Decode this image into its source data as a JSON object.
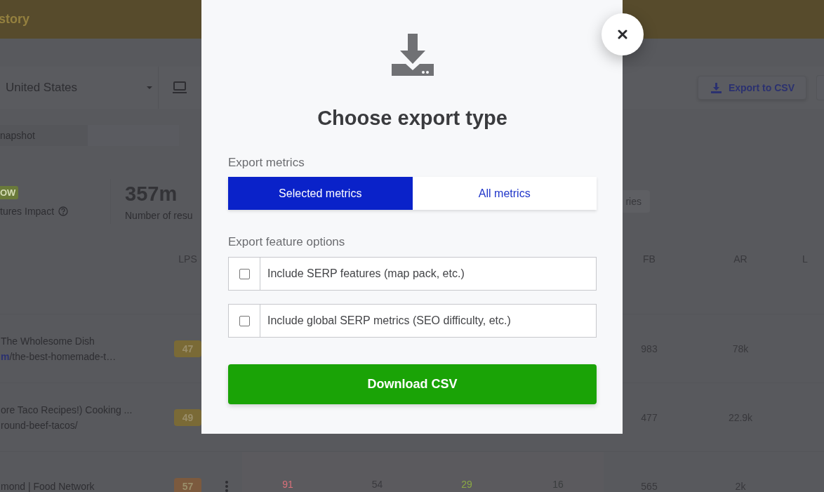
{
  "header": {
    "title": "story"
  },
  "toolbar": {
    "location": "United States",
    "export_button": "Export to CSV"
  },
  "view_tab": {
    "label": "napshot"
  },
  "stats": [
    {
      "badge": "OW",
      "label": "tures Impact"
    },
    {
      "value": "357m",
      "label": "Number of resu"
    }
  ],
  "chip": {
    "label": "ries"
  },
  "table": {
    "columns": [
      {
        "label": "LPS"
      },
      {
        "label": "FB"
      },
      {
        "label": "AR"
      },
      {
        "label": "L"
      }
    ],
    "rows": [
      {
        "title": "The Wholesome Dish",
        "url": "**m**/the-best-homemade-t…",
        "lps": "47",
        "color": "#7a6a36",
        "fb": "983",
        "ar": "78k"
      },
      {
        "title": "ore Taco Recipes!) Cooking ...",
        "url": "round-beef-tacos/",
        "lps": "49",
        "color": "#7a6a36",
        "fb": "477",
        "ar": "22.9k"
      },
      {
        "title": "mond | Food Network",
        "lps": "57",
        "color": "#7c5a3e",
        "menu": true,
        "metrics": [
          {
            "text": "91",
            "color": "#d8707a"
          },
          {
            "text": "54",
            "color": "#3a3a3e"
          },
          {
            "text": "29",
            "color": "#8aa844"
          },
          {
            "text": "16",
            "color": "#3a3d3e"
          }
        ],
        "fb": "565",
        "ar": "2k"
      }
    ]
  },
  "modal": {
    "title": "Choose export type",
    "metrics_label": "Export metrics",
    "metric_options": [
      {
        "label": "Selected metrics",
        "selected": true
      },
      {
        "label": "All metrics",
        "selected": false
      }
    ],
    "features_label": "Export feature options",
    "feature_options": [
      {
        "label": "Include SERP features (map pack, etc.)",
        "checked": false
      },
      {
        "label": "Include global SERP metrics (SEO difficulty, etc.)",
        "checked": false
      }
    ],
    "download_button": "Download CSV"
  }
}
